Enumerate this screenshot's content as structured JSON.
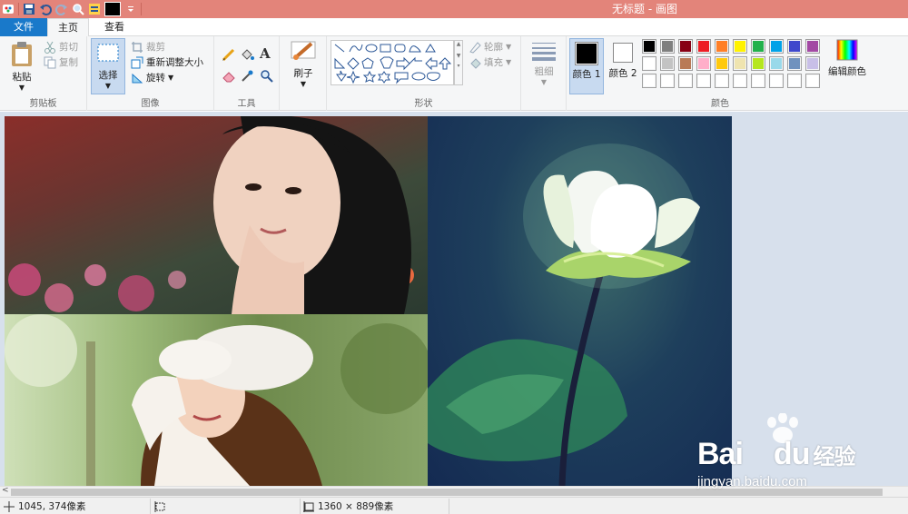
{
  "window": {
    "title": "无标题 - 画图"
  },
  "tabs": {
    "file": "文件",
    "home": "主页",
    "view": "查看"
  },
  "clipboard": {
    "paste": "粘贴",
    "cut": "剪切",
    "copy": "复制",
    "label": "剪贴板"
  },
  "image": {
    "select": "选择",
    "crop": "裁剪",
    "resize": "重新调整大小",
    "rotate": "旋转",
    "label": "图像"
  },
  "tools": {
    "label": "工具",
    "text_glyph": "A"
  },
  "brushes": {
    "label": "刷子"
  },
  "shapes": {
    "outline": "轮廓",
    "fill": "填充",
    "label": "形状"
  },
  "size": {
    "label": "粗细"
  },
  "colors": {
    "color1": "颜色 1",
    "color2": "颜色 2",
    "edit": "编辑颜色",
    "label": "颜色",
    "color1_value": "#000000",
    "color2_value": "#ffffff",
    "palette_row1": [
      "#000000",
      "#7f7f7f",
      "#880015",
      "#ed1c24",
      "#ff7f27",
      "#fff200",
      "#22b14c",
      "#00a2e8",
      "#3f48cc",
      "#a349a4"
    ],
    "palette_row2": [
      "#ffffff",
      "#c3c3c3",
      "#b97a57",
      "#ffaec9",
      "#ffc90e",
      "#efe4b0",
      "#b5e61d",
      "#99d9ea",
      "#7092be",
      "#c8bfe7"
    ],
    "palette_row3": [
      "#ffffff",
      "#ffffff",
      "#ffffff",
      "#ffffff",
      "#ffffff",
      "#ffffff",
      "#ffffff",
      "#ffffff",
      "#ffffff",
      "#ffffff"
    ]
  },
  "status": {
    "cursor": "1045, 374像素",
    "image_size": "1360 × 889像素"
  },
  "watermark": {
    "brand_a": "Bai",
    "brand_b": "du",
    "brand_cn": "经验",
    "url": "jingyan.baidu.com"
  }
}
